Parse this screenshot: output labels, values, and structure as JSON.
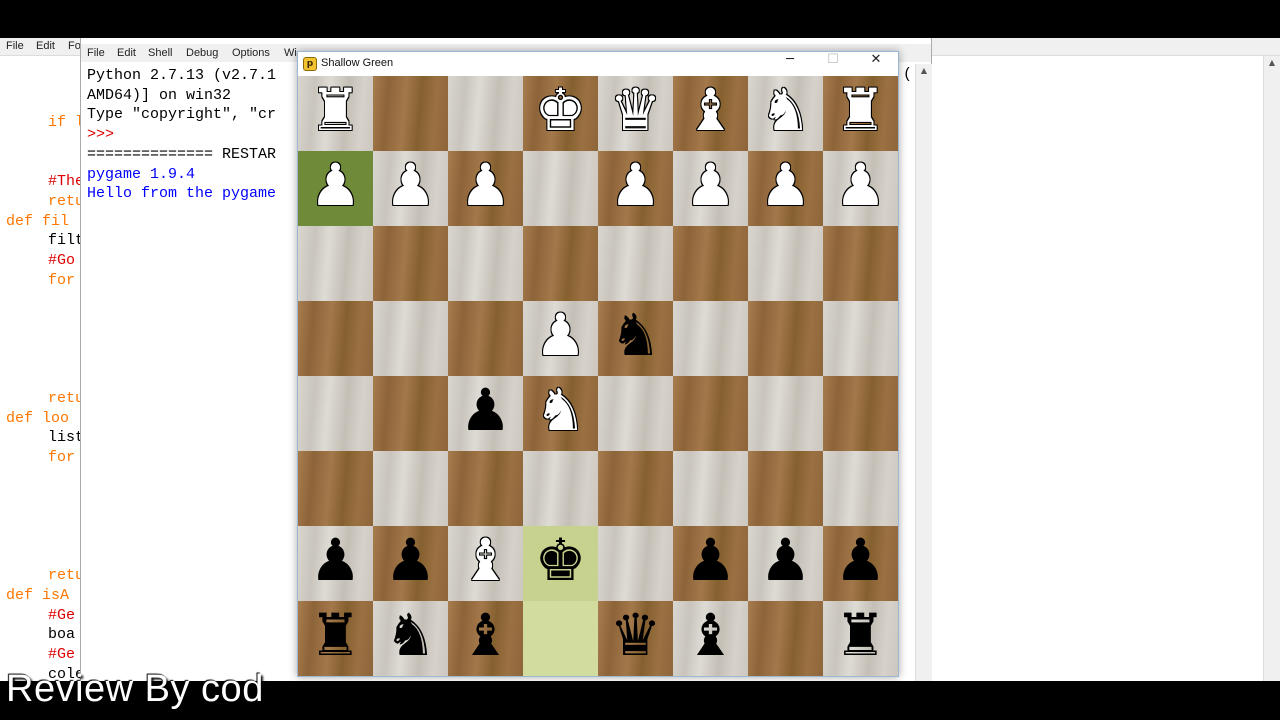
{
  "editor": {
    "menu": [
      "File",
      "Edit",
      "Fo"
    ],
    "code_lines": [
      {
        "text": "if l",
        "cls": "kw",
        "indent": 1,
        "row": 3
      },
      {
        "text": "#The",
        "cls": "cm",
        "indent": 1,
        "row": 6
      },
      {
        "text": "retu",
        "cls": "kw",
        "indent": 1,
        "row": 7
      },
      {
        "text": "def fil",
        "cls": "kw",
        "indent": 0,
        "row": 8
      },
      {
        "text": "filt",
        "cls": "nm",
        "indent": 1,
        "row": 9
      },
      {
        "text": "#Go",
        "cls": "cm",
        "indent": 1,
        "row": 10
      },
      {
        "text": "for",
        "cls": "kw",
        "indent": 1,
        "row": 11
      },
      {
        "text": "retu",
        "cls": "kw",
        "indent": 1,
        "row": 17
      },
      {
        "text": "def loo",
        "cls": "kw",
        "indent": 0,
        "row": 18
      },
      {
        "text": "list",
        "cls": "nm",
        "indent": 1,
        "row": 19
      },
      {
        "text": "for",
        "cls": "kw",
        "indent": 1,
        "row": 20
      },
      {
        "text": "retu",
        "cls": "kw",
        "indent": 1,
        "row": 26
      },
      {
        "text": "def isA",
        "cls": "kw",
        "indent": 0,
        "row": 27
      },
      {
        "text": "#Ge",
        "cls": "cm",
        "indent": 1,
        "row": 28
      },
      {
        "text": "boa",
        "cls": "nm",
        "indent": 1,
        "row": 29
      },
      {
        "text": "#Ge",
        "cls": "cm",
        "indent": 1,
        "row": 30
      },
      {
        "text": "colo",
        "cls": "nm",
        "indent": 1,
        "row": 31
      }
    ]
  },
  "shell": {
    "menu": [
      "File",
      "Edit",
      "Shell",
      "Debug",
      "Options",
      "Wi"
    ],
    "lines": [
      {
        "text": "Python 2.7.13 (v2.7.1",
        "cls": "nm"
      },
      {
        "text": "AMD64)] on win32",
        "cls": "nm"
      },
      {
        "text": "Type \"copyright\", \"cr",
        "cls": "nm"
      },
      {
        "text": ">>> ",
        "cls": "cm"
      },
      {
        "text": "============== RESTAR",
        "cls": "nm"
      },
      {
        "text": "pygame 1.9.4",
        "cls": "fn"
      },
      {
        "text": "Hello from the pygame",
        "cls": "fn"
      }
    ],
    "right_paren": "("
  },
  "game_window": {
    "title": "Shallow Green",
    "icon": "pygame-icon",
    "minimize": "─",
    "maximize": "☐",
    "close": "✕"
  },
  "board": {
    "ranks": [
      [
        "wR",
        "",
        "",
        "wK",
        "wQ",
        "wB",
        "wN",
        "wR"
      ],
      [
        "wP",
        "wP",
        "wP",
        "",
        "wP",
        "wP",
        "wP",
        "wP"
      ],
      [
        "",
        "",
        "",
        "",
        "",
        "",
        "",
        ""
      ],
      [
        "",
        "",
        "",
        "wP",
        "bN",
        "",
        "",
        ""
      ],
      [
        "",
        "",
        "bP",
        "wN",
        "",
        "",
        "",
        ""
      ],
      [
        "",
        "",
        "",
        "",
        "",
        "",
        "",
        ""
      ],
      [
        "bP",
        "bP",
        "wB",
        "bK",
        "",
        "bP",
        "bP",
        "bP"
      ],
      [
        "bR",
        "bN",
        "bB",
        "",
        "bQ",
        "bB",
        "",
        "bR"
      ]
    ],
    "highlights": [
      {
        "row": 1,
        "col": 0,
        "style": "olive"
      },
      {
        "row": 6,
        "col": 3,
        "style": "lime"
      },
      {
        "row": 7,
        "col": 3,
        "style": "lime2"
      }
    ],
    "glyphs": {
      "K": "♚",
      "Q": "♛",
      "R": "♜",
      "B": "♝",
      "N": "♞",
      "P": "♟"
    }
  },
  "overlay": {
    "text": "Review By cod"
  }
}
